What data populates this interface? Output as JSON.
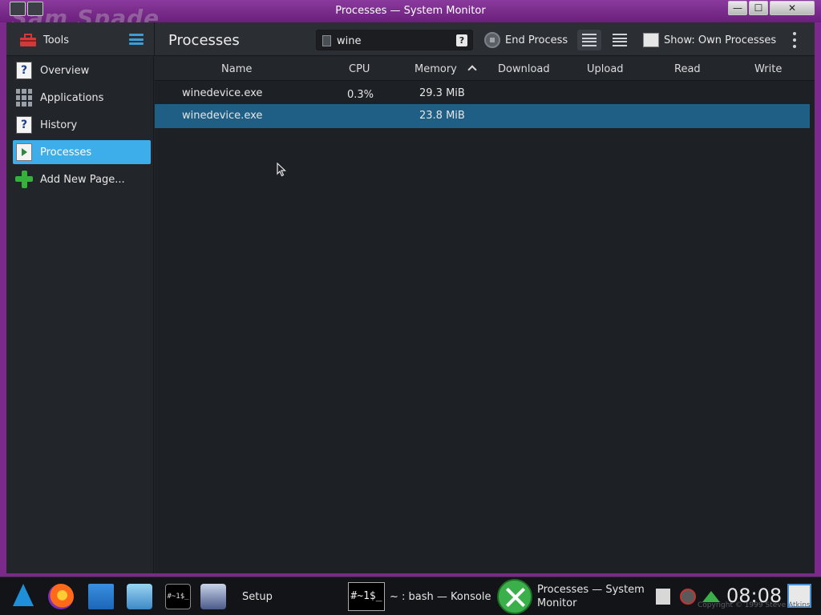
{
  "window": {
    "title": "Processes — System Monitor",
    "watermark": "Sam Spade",
    "buttons": {
      "minimize": "—",
      "maximize": "☐",
      "close": "✕"
    }
  },
  "toolbar": {
    "tools_label": "Tools",
    "page_title": "Processes",
    "search": {
      "value": "wine",
      "placeholder": ""
    },
    "end_process_label": "End Process",
    "show_label": "Show: Own Processes"
  },
  "sidebar": {
    "items": [
      {
        "label": "Overview",
        "icon": "help-icon"
      },
      {
        "label": "Applications",
        "icon": "applications-icon"
      },
      {
        "label": "History",
        "icon": "help-icon"
      },
      {
        "label": "Processes",
        "icon": "processes-icon",
        "selected": true
      },
      {
        "label": "Add New Page...",
        "icon": "add-icon"
      }
    ]
  },
  "table": {
    "columns": {
      "name": "Name",
      "cpu": "CPU",
      "memory": "Memory",
      "download": "Download",
      "upload": "Upload",
      "read": "Read",
      "write": "Write"
    },
    "sorted_by": "Memory",
    "rows": [
      {
        "name": "winedevice.exe",
        "cpu": "0.3%",
        "memory": "29.3 MiB",
        "selected": false
      },
      {
        "name": "winedevice.exe",
        "cpu": "",
        "memory": "23.8 MiB",
        "selected": true
      }
    ]
  },
  "taskbar": {
    "setup_label": "Setup",
    "konsole_icon_text": "#~1$_",
    "konsole_label": "~ : bash — Konsole",
    "sysmon_label_line1": "Processes — System",
    "sysmon_label_line2": "Monitor",
    "term_mini_text": "#~1$_",
    "clock": "08:08",
    "copyright": "Copyright © 1999 Steve Atkins"
  },
  "colors": {
    "accent": "#3daee9",
    "selected_row": "#1f5f85",
    "titlebar": "#7b2a8c"
  }
}
